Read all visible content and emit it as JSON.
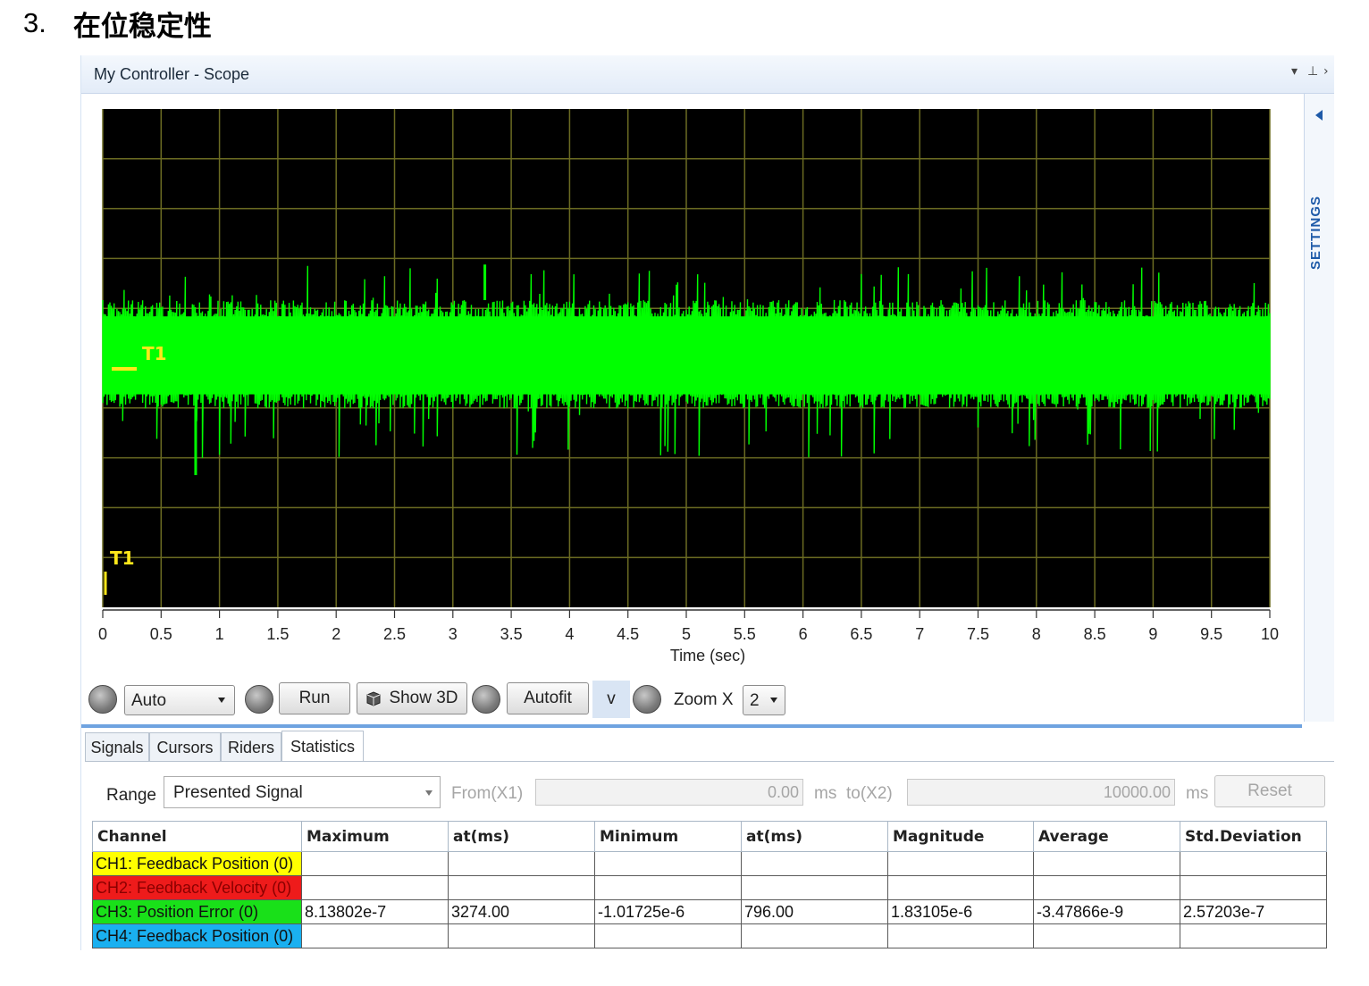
{
  "doc": {
    "step_number": "3.",
    "step_title": "在位稳定性"
  },
  "window": {
    "title": "My Controller - Scope",
    "settings_label": "SETTINGS"
  },
  "scope": {
    "background": "#000000",
    "grid_color": "#6b6b22",
    "signal_color": "#00ff00",
    "trigger_color": "#ffe81a",
    "markers": [
      "T1",
      "T1"
    ]
  },
  "chart_data": {
    "type": "line",
    "xlabel": "Time (sec)",
    "ylabel": "",
    "xlim": [
      0,
      10
    ],
    "xticks": [
      "0",
      "0.5",
      "1",
      "1.5",
      "2",
      "2.5",
      "3",
      "3.5",
      "4",
      "4.5",
      "5",
      "5.5",
      "6",
      "6.5",
      "7",
      "7.5",
      "8",
      "8.5",
      "9",
      "9.5",
      "10"
    ],
    "series": [
      {
        "color": "#00ff00",
        "band_max": 8.13802e-07,
        "band_min": -1.01725e-06,
        "max_at_ms": 3274.0,
        "min_at_ms": 796.0
      }
    ]
  },
  "controls": {
    "mode": "Auto",
    "run": "Run",
    "show3d": "Show 3D",
    "autofit": "Autofit",
    "v": "v",
    "zoom_label": "Zoom X",
    "zoom_value": "2"
  },
  "tabs": [
    {
      "label": "Signals",
      "active": false
    },
    {
      "label": "Cursors",
      "active": false
    },
    {
      "label": "Riders",
      "active": false
    },
    {
      "label": "Statistics",
      "active": true
    }
  ],
  "range": {
    "label": "Range",
    "value": "Presented Signal",
    "from_label": "From(X1)",
    "from_value": "0.00",
    "unit1": "ms",
    "to_label": "to(X2)",
    "to_value": "10000.00",
    "unit2": "ms",
    "reset": "Reset"
  },
  "stats": {
    "headers": [
      "Channel",
      "Maximum",
      "at(ms)",
      "Minimum",
      "at(ms)",
      "Magnitude",
      "Average",
      "Std.Deviation"
    ],
    "rows": [
      {
        "channel": "CH1: Feedback Position (0)",
        "color": "#ffff00",
        "text_color": "#111111",
        "values": [
          "",
          "",
          "",
          "",
          "",
          "",
          ""
        ]
      },
      {
        "channel": "CH2: Feedback Velocity (0)",
        "color": "#ee1b1b",
        "text_color": "#8a0000",
        "values": [
          "",
          "",
          "",
          "",
          "",
          "",
          ""
        ]
      },
      {
        "channel": "CH3: Position Error (0)",
        "color": "#19e019",
        "text_color": "#111111",
        "values": [
          "8.13802e-7",
          "3274.00",
          "-1.01725e-6",
          "796.00",
          "1.83105e-6",
          "-3.47866e-9",
          "2.57203e-7"
        ]
      },
      {
        "channel": "CH4: Feedback Position (0)",
        "color": "#1ab0f0",
        "text_color": "#111111",
        "values": [
          "",
          "",
          "",
          "",
          "",
          "",
          ""
        ]
      }
    ]
  }
}
